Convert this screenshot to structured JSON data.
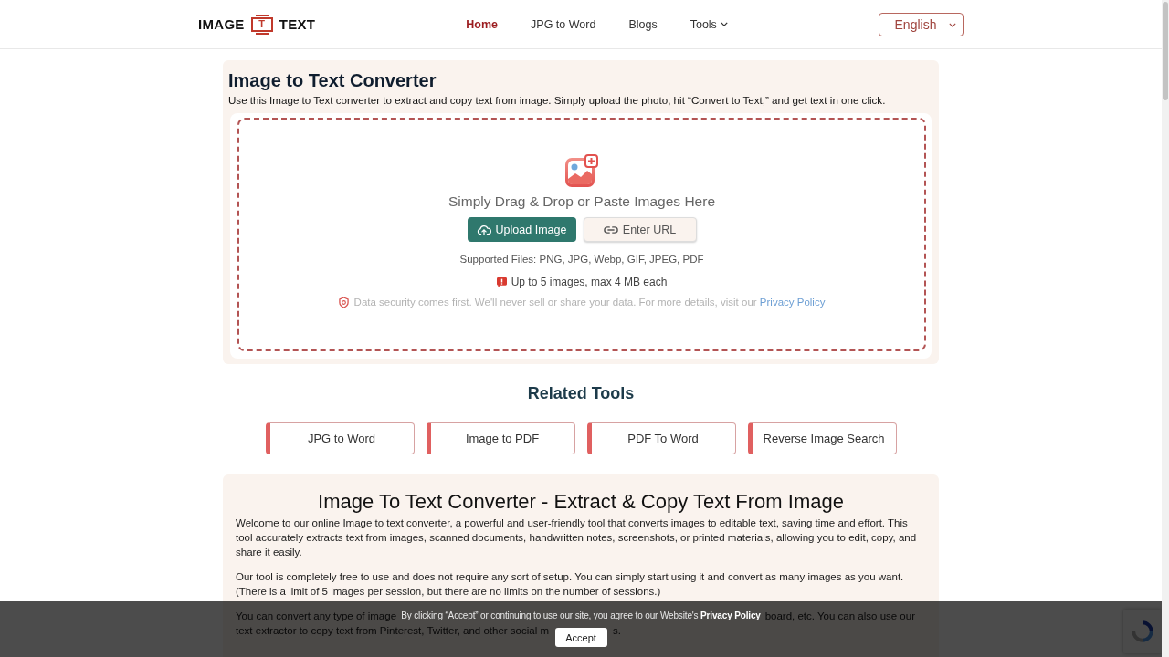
{
  "header": {
    "logo": {
      "left": "IMAGE",
      "mark": "T",
      "right": "TEXT"
    },
    "nav": [
      {
        "label": "Home",
        "selected": true,
        "dropdown": false
      },
      {
        "label": "JPG to Word",
        "selected": false,
        "dropdown": false
      },
      {
        "label": "Blogs",
        "selected": false,
        "dropdown": false
      },
      {
        "label": "Tools",
        "selected": false,
        "dropdown": true
      }
    ],
    "language": "English"
  },
  "converter": {
    "title": "Image to Text Converter",
    "description": "Use this Image to Text converter to extract and copy text from image. Simply upload the photo, hit “Convert to Text,” and get text in one click.",
    "upload": {
      "prompt": "Simply Drag & Drop or Paste Images Here",
      "buttons": [
        {
          "label": "Upload Image",
          "kind": "upload"
        },
        {
          "label": "Enter URL",
          "kind": "url"
        }
      ],
      "supported": "Supported Files: PNG, JPG, Webp, GIF, JPEG, PDF",
      "limit": "Up to 5 images, max 4 MB each",
      "security": {
        "text": "Data security comes first. We'll never sell or share your data. For more details, visit our",
        "link": "Privacy Policy"
      }
    }
  },
  "related_tools": {
    "title": "Related Tools",
    "items": [
      "JPG to Word",
      "Image to PDF",
      "PDF To Word",
      "Reverse Image Search"
    ]
  },
  "article": {
    "title": "Image To Text Converter - Extract & Copy Text From Image",
    "paragraphs": [
      "Welcome to our online Image to text converter, a powerful and user-friendly tool that converts images to editable text, saving time and effort. This tool accurately extracts text from images, scanned documents, handwritten notes, screenshots, or printed materials, allowing you to edit, copy, and share it easily.",
      "Our tool is completely free to use and does not require any sort of setup. You can simply start using it and convert as many images as you want. (There is a limit of 5 images per session, but there are no limits on the number of sessions.)"
    ],
    "covered_paragraph": [
      [
        "You can convert any type of image",
        "board, etc. You can also use our"
      ],
      [
        "text extractor to copy text from Pinterest, Twitter, and other social m",
        "s."
      ]
    ]
  },
  "cookie_bar": {
    "text": "By clicking “Accept” or continuing to use our site, you agree to our Website's",
    "link": "Privacy Policy",
    "button": "Accept"
  }
}
